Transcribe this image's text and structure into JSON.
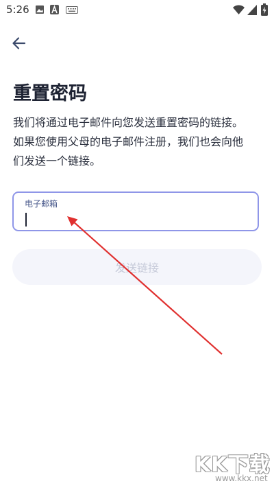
{
  "status_bar": {
    "time": "5:26",
    "icons": [
      "image-icon",
      "a-icon",
      "keyboard-icon",
      "wifi-icon",
      "signal-icon",
      "battery-charging-icon"
    ]
  },
  "header": {
    "back_icon": "arrow-left-icon"
  },
  "main": {
    "title": "重置密码",
    "description": "我们将通过电子邮件向您发送重置密码的链接。如果您使用父母的电子邮件注册，我们也会向他们发送一个链接。",
    "email_field": {
      "label": "电子邮箱",
      "value": ""
    },
    "send_button": {
      "label": "发送链接"
    }
  },
  "watermark": {
    "logo": "KK下载",
    "url": "www.kkx.net"
  },
  "colors": {
    "field_border": "#8f96e8",
    "button_bg": "#f4f5fb",
    "button_text": "#c6cad9",
    "annotation_arrow": "#e0302f"
  }
}
